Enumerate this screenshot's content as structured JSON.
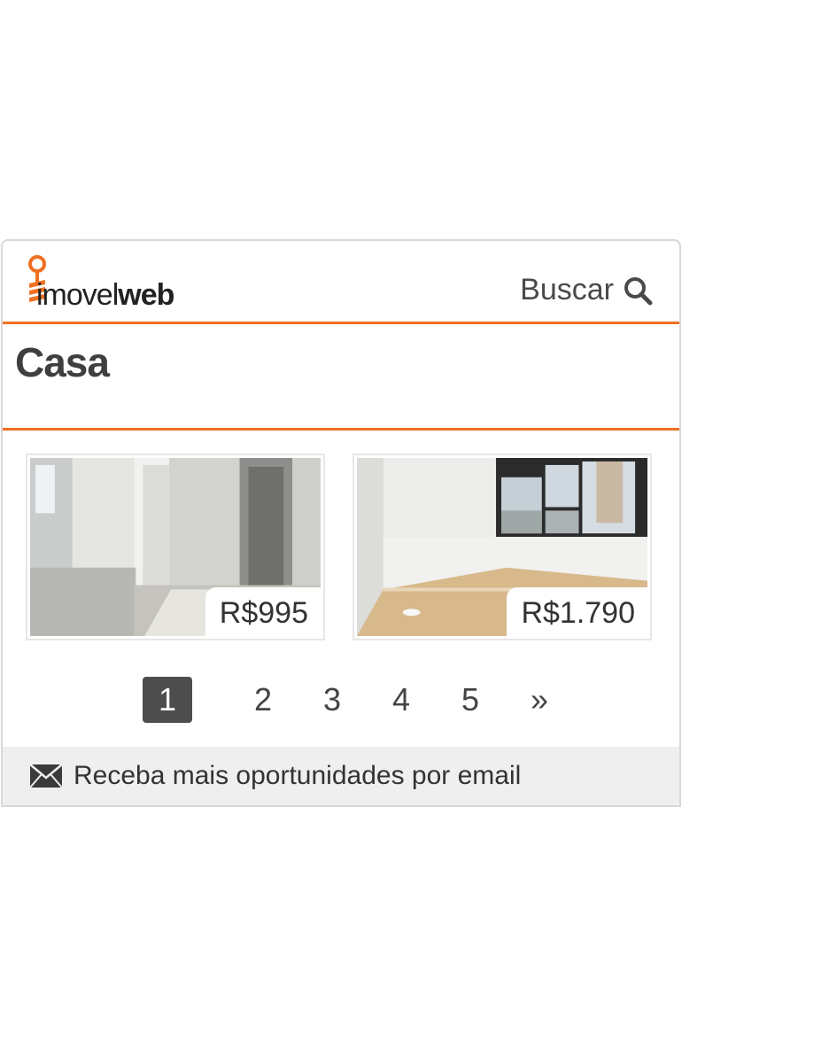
{
  "brand": {
    "name_light": "imovel",
    "name_bold": "web",
    "accent": "#f07021"
  },
  "header": {
    "search_label": "Buscar",
    "search_icon": "search-icon"
  },
  "title": "Casa",
  "listings": [
    {
      "price": "R$995"
    },
    {
      "price": "R$1.790"
    }
  ],
  "pagination": {
    "pages": [
      "1",
      "2",
      "3",
      "4",
      "5"
    ],
    "next": "»",
    "current": "1"
  },
  "footer": {
    "text": "Receba mais oportunidades por email",
    "icon": "envelope-icon"
  }
}
